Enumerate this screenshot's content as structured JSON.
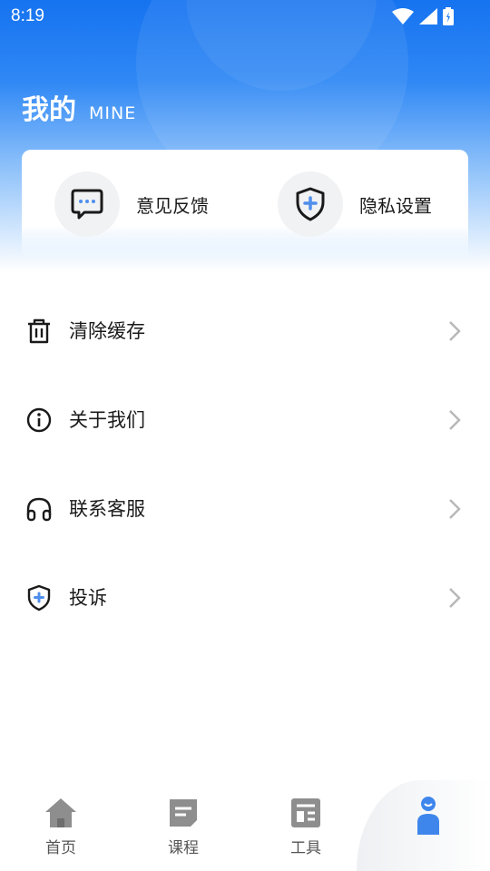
{
  "status_bar": {
    "time": "8:19"
  },
  "header": {
    "title": "我的",
    "subtitle": "MINE"
  },
  "quick_actions": [
    {
      "label": "意见反馈",
      "icon": "chat-bubble-icon"
    },
    {
      "label": "隐私设置",
      "icon": "shield-plus-icon"
    }
  ],
  "menu": [
    {
      "label": "清除缓存",
      "icon": "trash-icon"
    },
    {
      "label": "关于我们",
      "icon": "info-icon"
    },
    {
      "label": "联系客服",
      "icon": "headset-icon"
    },
    {
      "label": "投诉",
      "icon": "shield-plus-icon"
    }
  ],
  "tabs": [
    {
      "label": "首页",
      "icon": "home-icon"
    },
    {
      "label": "课程",
      "icon": "course-icon"
    },
    {
      "label": "工具",
      "icon": "tools-icon"
    },
    {
      "label": "",
      "icon": "user-icon",
      "active": true
    }
  ],
  "colors": {
    "brand": "#1673f0",
    "accent": "#4f8fec"
  }
}
